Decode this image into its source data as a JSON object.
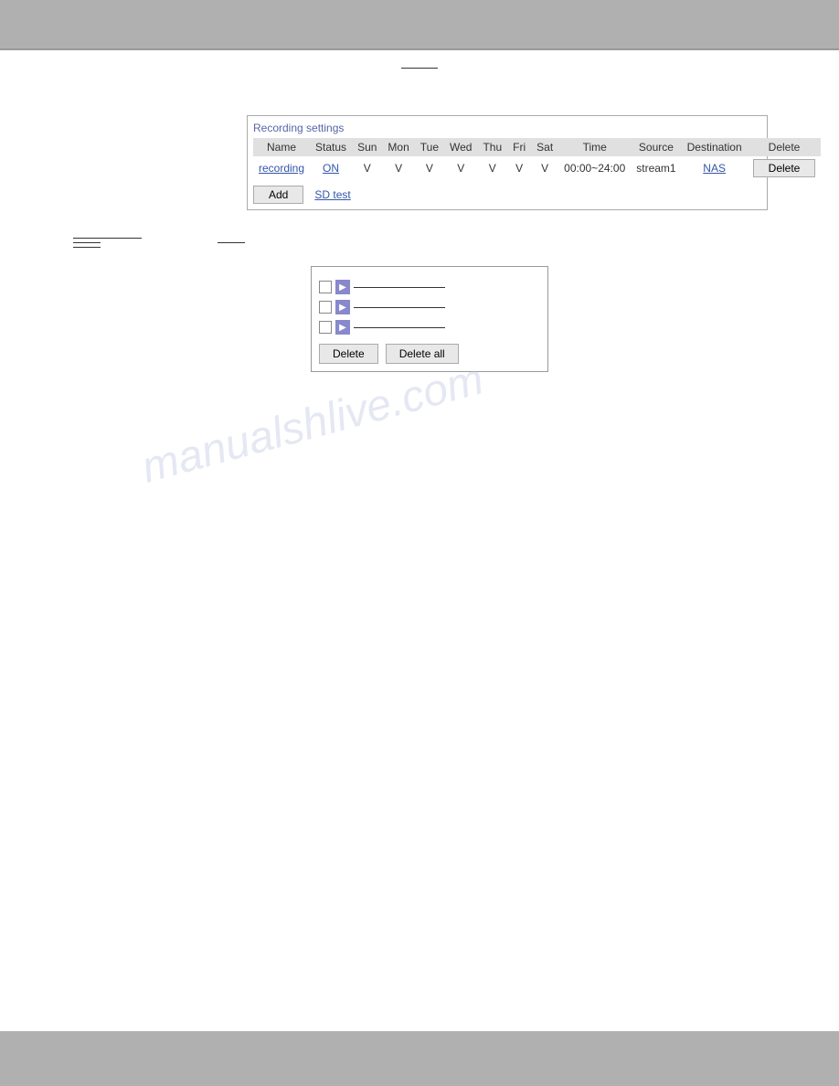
{
  "header": {
    "bg_color": "#b0b0b0"
  },
  "recording_settings": {
    "title": "Recording settings",
    "columns": [
      "Name",
      "Status",
      "Sun",
      "Mon",
      "Tue",
      "Wed",
      "Thu",
      "Fri",
      "Sat",
      "Time",
      "Source",
      "Destination",
      "Delete"
    ],
    "row": {
      "name": "recording",
      "status": "ON",
      "sun": "V",
      "mon": "V",
      "tue": "V",
      "wed": "V",
      "thu": "V",
      "fri": "V",
      "sat": "V",
      "time": "00:00~24:00",
      "source": "stream1",
      "destination": "NAS",
      "delete_btn": "Delete"
    },
    "add_btn": "Add",
    "sd_test_link": "SD test"
  },
  "section": {
    "line1": "",
    "line2": "",
    "line3": ""
  },
  "file_list": {
    "items": [
      {
        "id": 1
      },
      {
        "id": 2
      },
      {
        "id": 3
      }
    ],
    "delete_btn": "Delete",
    "delete_all_btn": "Delete all"
  },
  "watermark": "manualshlive.com"
}
